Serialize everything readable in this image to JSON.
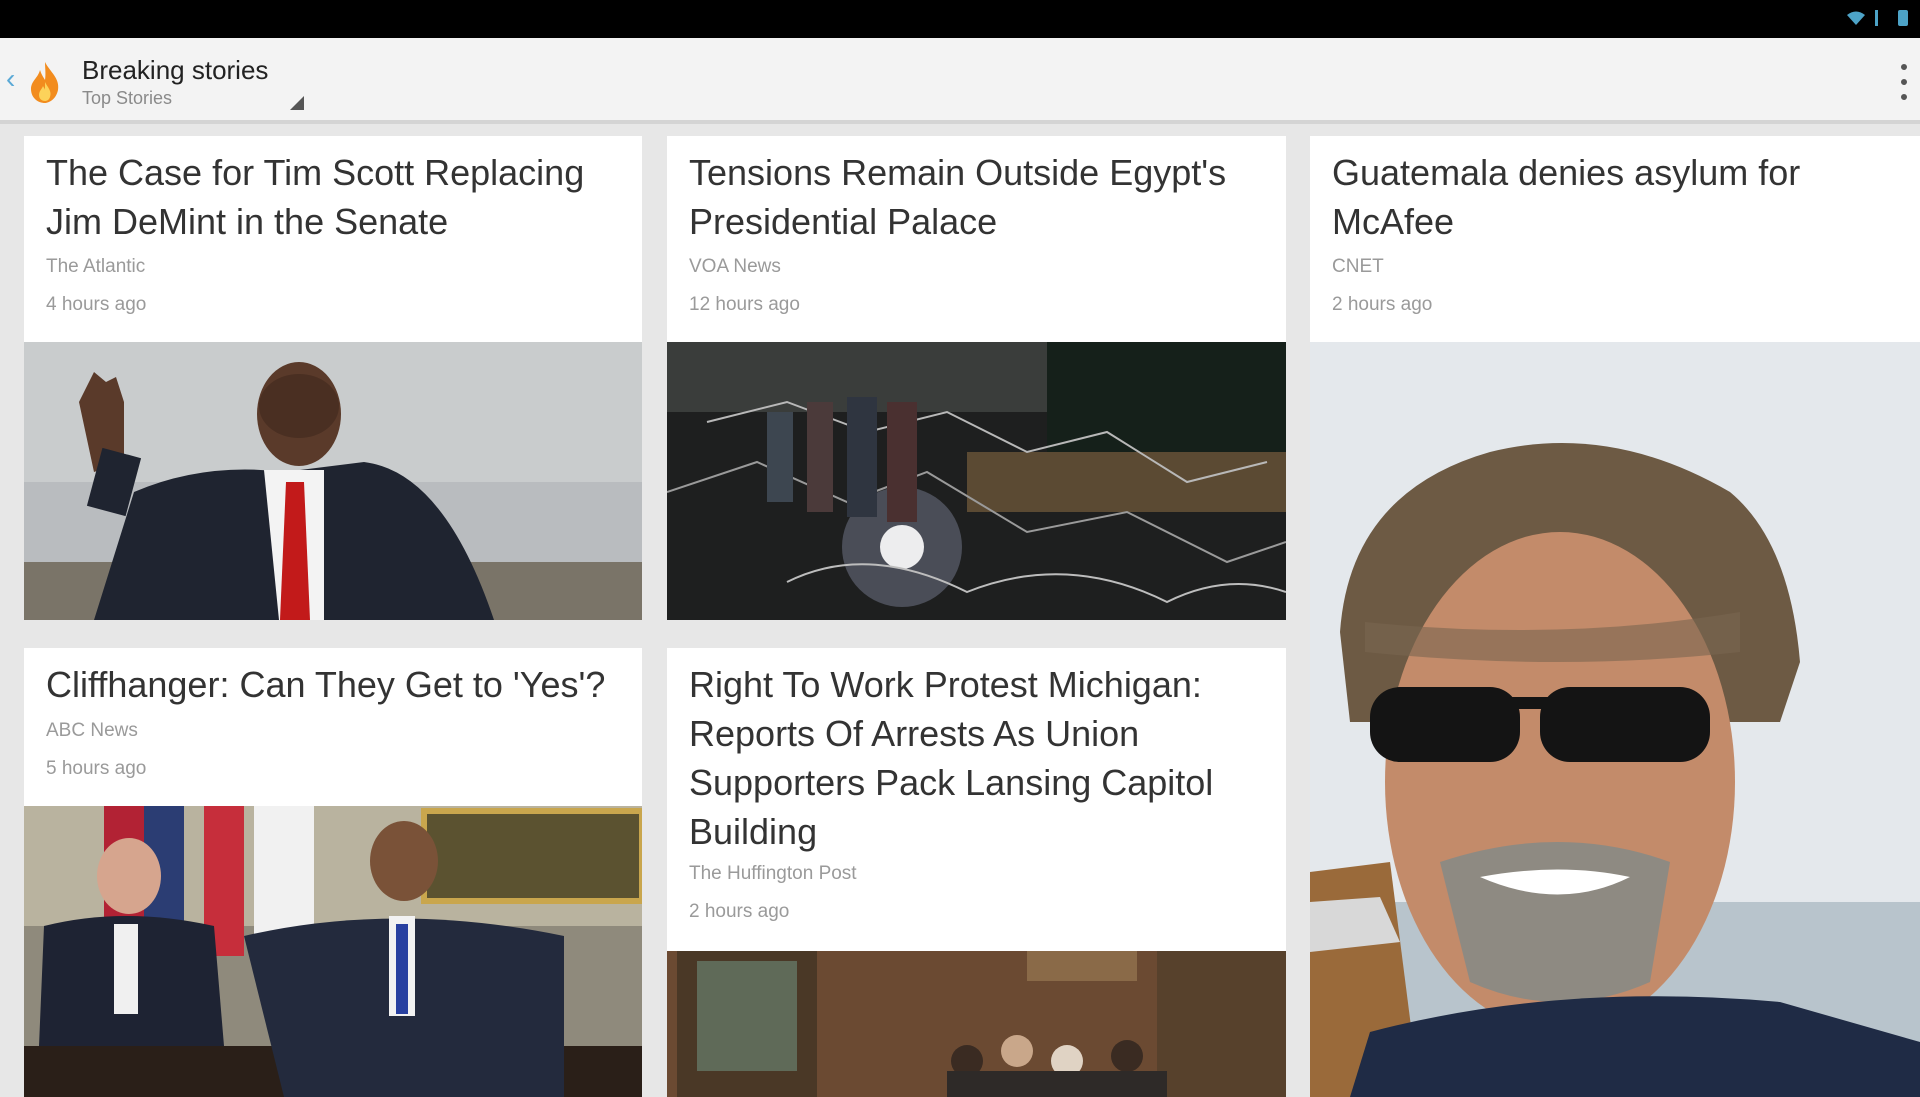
{
  "action_bar": {
    "title": "Breaking stories",
    "subtitle": "Top Stories"
  },
  "icons": {
    "back": "chevron-left-icon",
    "section": "flame-icon",
    "overflow": "overflow-menu-icon",
    "status": [
      "wifi-icon",
      "signal-icon",
      "battery-icon"
    ]
  },
  "colors": {
    "status_icons": "#4da3c7",
    "back_arrow": "#5aa9d6",
    "flame": "#f28c1e"
  },
  "stories": [
    {
      "title": "The Case for Tim Scott Replacing Jim DeMint in the Senate",
      "source": "The Atlantic",
      "time": "4 hours ago",
      "image": "photo-man-waving"
    },
    {
      "title": "Tensions Remain Outside Egypt's Presidential Palace",
      "source": "VOA News",
      "time": "12 hours ago",
      "image": "photo-barbed-wire-night"
    },
    {
      "title": "Guatemala denies asylum for McAfee",
      "source": "CNET",
      "time": "2 hours ago",
      "image": "photo-man-sunglasses"
    },
    {
      "title": "Cliffhanger: Can They Get to 'Yes'?",
      "source": "ABC News",
      "time": "5 hours ago",
      "image": "photo-oval-office-meeting"
    },
    {
      "title": "Right To Work Protest Michigan: Reports Of Arrests As Union Supporters Pack Lansing Capitol Building",
      "source": "The Huffington Post",
      "time": "2 hours ago",
      "image": "photo-capitol-crowd"
    }
  ]
}
